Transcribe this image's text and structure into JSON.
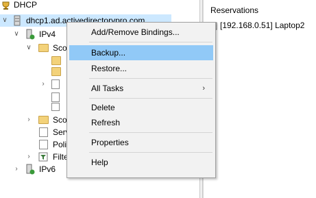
{
  "tree": {
    "root": "DHCP",
    "server": "dhcp1.ad.activedirectorypro.com",
    "ipv4": "IPv4",
    "scope_partial": "Sco",
    "scope2_partial": "Sco",
    "server_options_partial": "Serv",
    "policies_partial": "Poli",
    "filters_partial": "Filte",
    "ipv6": "IPv6"
  },
  "context_menu": {
    "items": [
      "Add/Remove Bindings...",
      "Backup...",
      "Restore...",
      "All Tasks",
      "Delete",
      "Refresh",
      "Properties",
      "Help"
    ],
    "highlighted": "Backup..."
  },
  "right_panel": {
    "header": "Reservations",
    "item": "[192.168.0.51] Laptop2"
  },
  "colors": {
    "selection": "#cce8ff",
    "menu_highlight": "#91c9f7",
    "menu_bg": "#f2f2f2"
  }
}
